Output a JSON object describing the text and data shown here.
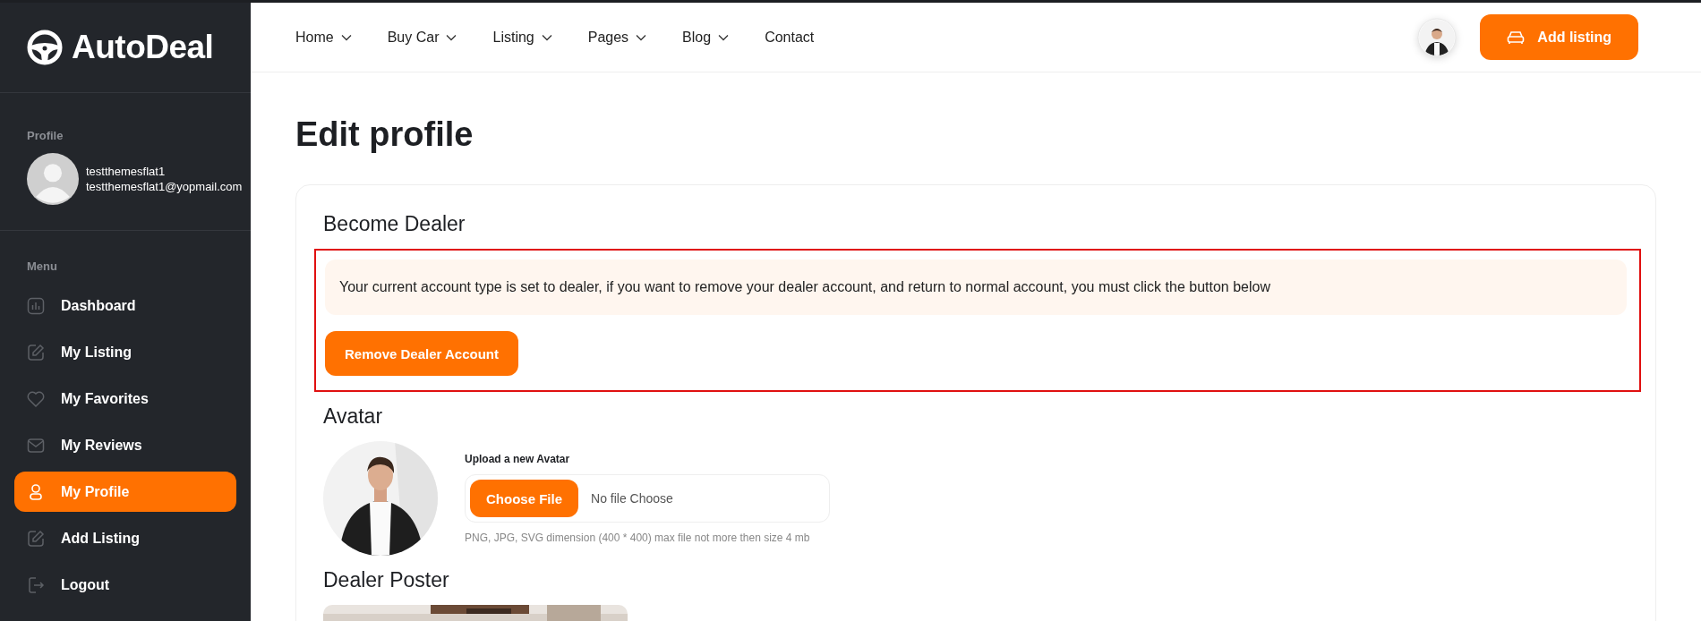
{
  "brand": {
    "name": "AutoDeal"
  },
  "sidebar": {
    "profile_label": "Profile",
    "user": {
      "name": "testthemesflat1",
      "email": "testthemesflat1@yopmail.com"
    },
    "menu_label": "Menu",
    "items": [
      {
        "label": "Dashboard",
        "kind": "chart",
        "selected": false
      },
      {
        "label": "My Listing",
        "kind": "edit",
        "selected": false
      },
      {
        "label": "My Favorites",
        "kind": "heart",
        "selected": false
      },
      {
        "label": "My Reviews",
        "kind": "mail",
        "selected": false
      },
      {
        "label": "My Profile",
        "kind": "user",
        "selected": true
      },
      {
        "label": "Add Listing",
        "kind": "edit",
        "selected": false
      },
      {
        "label": "Logout",
        "kind": "logout",
        "selected": false
      }
    ]
  },
  "nav": {
    "items": [
      {
        "label": "Home",
        "dropdown": true
      },
      {
        "label": "Buy Car",
        "dropdown": true
      },
      {
        "label": "Listing",
        "dropdown": true
      },
      {
        "label": "Pages",
        "dropdown": true
      },
      {
        "label": "Blog",
        "dropdown": true
      },
      {
        "label": "Contact",
        "dropdown": false
      }
    ],
    "add_listing": "Add listing"
  },
  "page": {
    "title": "Edit profile",
    "become_dealer": {
      "heading": "Become Dealer",
      "notice": "Your current account type is set to dealer, if you want to remove your dealer account, and return to normal account, you must click the button below",
      "button": "Remove Dealer Account"
    },
    "avatar": {
      "heading": "Avatar",
      "upload_label": "Upload a new Avatar",
      "choose_button": "Choose File",
      "file_status": "No file Choose",
      "hint": "PNG, JPG, SVG dimension (400 * 400) max file not more then size 4 mb"
    },
    "dealer_poster": {
      "heading": "Dealer Poster"
    }
  }
}
